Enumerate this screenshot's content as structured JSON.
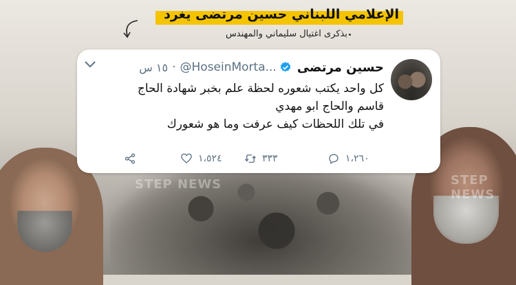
{
  "headline": {
    "title": "الإعلامي اللبناني حسين مرتضى يغرد",
    "subtitle": "بذكرى اغتيال سليماني والمهندس"
  },
  "tweet": {
    "display_name": "حسين مرتضى",
    "handle": "@HoseinMorta...",
    "separator": "·",
    "time": "١٥ س",
    "lines": [
      "كل واحد يكتب شعوره لحظة علم بخبر شهادة الحاج",
      "قاسم والحاج ابو مهدي",
      "في تلك اللحظات كيف عرفت وما هو شعورك"
    ],
    "reply_count": "١،٢٦٠",
    "retweet_count": "٣٣٣",
    "like_count": "١،٥٢٤"
  },
  "watermark": "STEP NEWS",
  "colors": {
    "accent_bar": "#f5c400",
    "verified": "#1da1f2",
    "secondary_text": "#5b7083"
  },
  "icons": {
    "verified": "verified-badge-icon",
    "chevron": "chevron-down-icon",
    "reply": "reply-icon",
    "retweet": "retweet-icon",
    "like": "heart-icon",
    "share": "share-icon"
  }
}
